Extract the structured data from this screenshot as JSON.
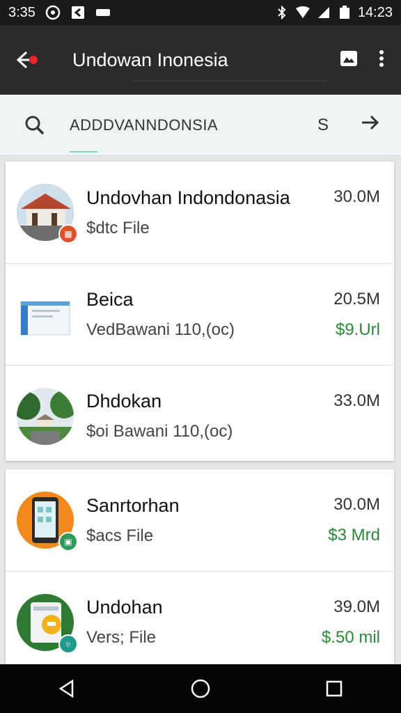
{
  "status_bar": {
    "time_left": "3:35",
    "time_right": "14:23"
  },
  "app_bar": {
    "title": "Undowan Inonesia"
  },
  "search": {
    "query": "ADDDVANNDONSIA",
    "trailing_letter": "S"
  },
  "list": [
    {
      "name": "Undovhan Indondonasia",
      "subtitle": "$dtc File",
      "size": "30.0M",
      "price": "",
      "thumb": "house"
    },
    {
      "name": "Beica",
      "subtitle": "VedBawani 110,(oc)",
      "size": "20.5M",
      "price": "$9.Url",
      "thumb": "box"
    },
    {
      "name": "Dhdokan",
      "subtitle": "$oi Bawani 110,(oc)",
      "size": "33.0M",
      "price": "",
      "thumb": "park"
    },
    {
      "name": "Sanrtorhan",
      "subtitle": "$acs File",
      "size": "30.0M",
      "price": "$3 Mrd",
      "thumb": "phone"
    },
    {
      "name": "Undohan",
      "subtitle": "Vers; File",
      "size": "39.0M",
      "price": "$.50 mil",
      "thumb": "device"
    }
  ],
  "colors": {
    "app_bar": "#2b2b2b",
    "status_bar": "#1a1a1a",
    "price_green": "#2a8a38",
    "back_dot": "#e5262b"
  }
}
